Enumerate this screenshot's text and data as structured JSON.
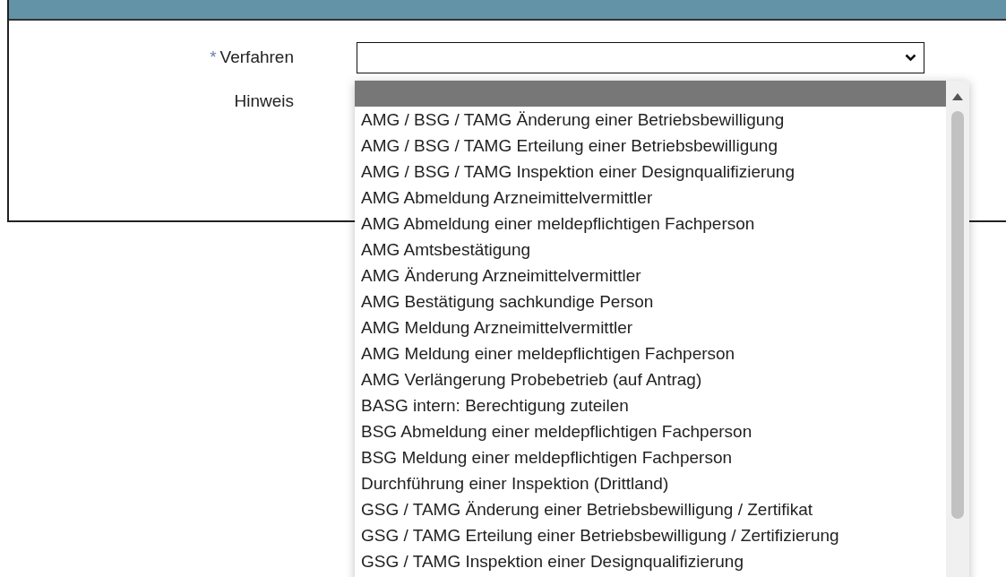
{
  "form": {
    "fields": [
      {
        "marker": "*",
        "label": "Verfahren",
        "kind": "select"
      },
      {
        "label": "Hinweis",
        "kind": "note"
      }
    ]
  },
  "dropdown": {
    "options": [
      {
        "selected": true
      },
      {
        "label": "AMG / BSG / TAMG Änderung einer Betriebsbewilligung",
        "selected": false
      },
      {
        "label": "AMG / BSG / TAMG Erteilung einer Betriebsbewilligung",
        "selected": false
      },
      {
        "label": "AMG / BSG / TAMG Inspektion einer Designqualifizierung",
        "selected": false
      },
      {
        "label": "AMG Abmeldung Arzneimittelvermittler",
        "selected": false
      },
      {
        "label": "AMG Abmeldung einer meldepflichtigen Fachperson",
        "selected": false
      },
      {
        "label": "AMG Amtsbestätigung",
        "selected": false
      },
      {
        "label": "AMG Änderung Arzneimittelvermittler",
        "selected": false
      },
      {
        "label": "AMG Bestätigung sachkundige Person",
        "selected": false
      },
      {
        "label": "AMG Meldung Arzneimittelvermittler",
        "selected": false
      },
      {
        "label": "AMG Meldung einer meldepflichtigen Fachperson",
        "selected": false
      },
      {
        "label": "AMG Verlängerung Probebetrieb (auf Antrag)",
        "selected": false
      },
      {
        "label": "BASG intern: Berechtigung zuteilen",
        "selected": false
      },
      {
        "label": "BSG Abmeldung einer meldepflichtigen Fachperson",
        "selected": false
      },
      {
        "label": "BSG Meldung einer meldepflichtigen Fachperson",
        "selected": false
      },
      {
        "label": "Durchführung einer Inspektion (Drittland)",
        "selected": false
      },
      {
        "label": "GSG / TAMG Änderung einer Betriebsbewilligung / Zertifikat",
        "selected": false
      },
      {
        "label": "GSG / TAMG Erteilung einer Betriebsbewilligung / Zertifizierung",
        "selected": false
      },
      {
        "label": "GSG / TAMG Inspektion einer Designqualifizierung",
        "selected": false
      }
    ]
  }
}
